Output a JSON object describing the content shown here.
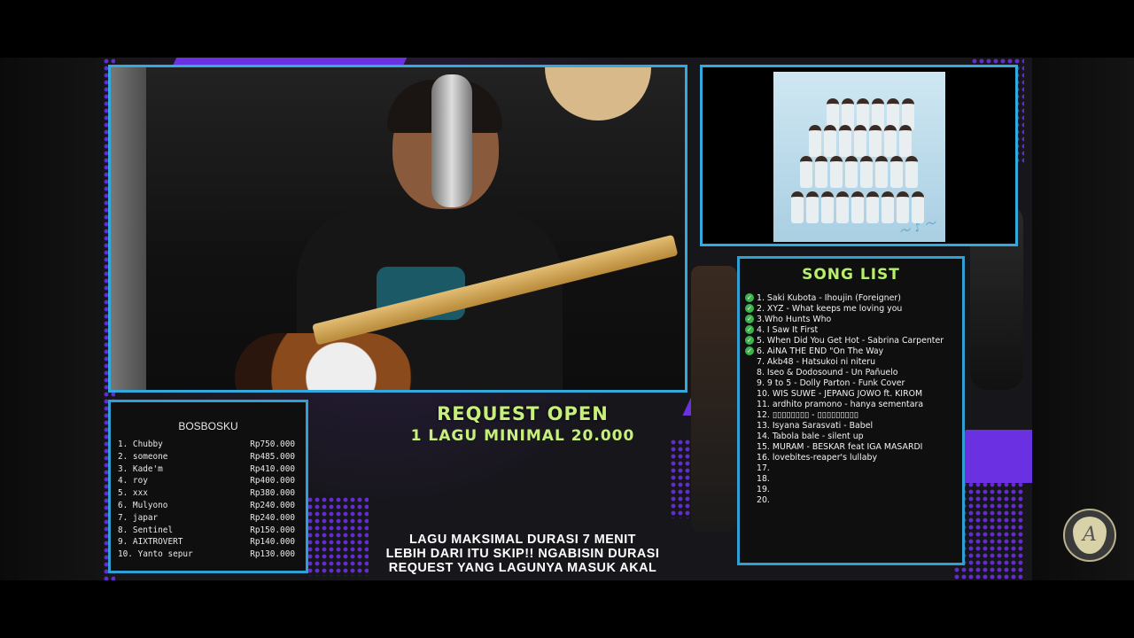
{
  "request": {
    "line1": "REQUEST OPEN",
    "line2": "1 LAGU MINIMAL 20.000"
  },
  "rules": [
    "LAGU MAKSIMAL DURASI 7 MENIT",
    "LEBIH DARI ITU SKIP!! NGABISIN DURASI",
    "REQUEST YANG LAGUNYA MASUK AKAL"
  ],
  "leaderboard": {
    "title": "BOSBOSKU",
    "entries": [
      {
        "name": "1. Chubby",
        "amount": "Rp750.000"
      },
      {
        "name": "2. someone",
        "amount": "Rp485.000"
      },
      {
        "name": "3. Kade'm",
        "amount": "Rp410.000"
      },
      {
        "name": "4. roy",
        "amount": "Rp400.000"
      },
      {
        "name": "5. xxx",
        "amount": "Rp380.000"
      },
      {
        "name": "6. Mulyono",
        "amount": "Rp240.000"
      },
      {
        "name": "7. japar",
        "amount": "Rp240.000"
      },
      {
        "name": "8. Sentinel",
        "amount": "Rp150.000"
      },
      {
        "name": "9. AIXTROVERT",
        "amount": "Rp140.000"
      },
      {
        "name": "10. Yanto sepur",
        "amount": "Rp130.000"
      }
    ]
  },
  "song_list": {
    "title": "SONG LIST",
    "items": [
      {
        "text": "1. Saki Kubota - Ihoujin (Foreigner)",
        "done": true
      },
      {
        "text": "2. XYZ - What keeps me loving you",
        "done": true
      },
      {
        "text": "3.Who Hunts Who",
        "done": true
      },
      {
        "text": "4. I Saw It First",
        "done": true
      },
      {
        "text": "5. When Did You Get Hot - Sabrina Carpenter",
        "done": true
      },
      {
        "text": "6. AiNA THE END \"On The Way",
        "done": true
      },
      {
        "text": "7. Akb48 - Hatsukoi ni niteru",
        "done": false
      },
      {
        "text": "8. Iseo & Dodosound - Un Pañuelo",
        "done": false
      },
      {
        "text": "9. 9 to 5 - Dolly Parton - Funk Cover",
        "done": false
      },
      {
        "text": "10. WIS SUWE - JEPANG JOWO ft. KIROM",
        "done": false
      },
      {
        "text": "11. ardhito pramono - hanya sementara",
        "done": false
      },
      {
        "text": "12. ▯▯▯▯▯▯▯▯ - ▯▯▯▯▯▯▯▯▯",
        "done": false
      },
      {
        "text": "13. Isyana Sarasvati - Babel",
        "done": false
      },
      {
        "text": "14. Tabola bale - silent up",
        "done": false
      },
      {
        "text": "15. MURAM - BESKAR feat IGA MASARDI",
        "done": false
      },
      {
        "text": "16. lovebites-reaper's lullaby",
        "done": false
      },
      {
        "text": "17.",
        "done": false
      },
      {
        "text": "18.",
        "done": false
      },
      {
        "text": "19.",
        "done": false
      },
      {
        "text": "20.",
        "done": false
      }
    ]
  },
  "icons": {
    "done_marker": "check-circle-icon",
    "channel_logo": "guitar-pick-logo-icon"
  },
  "colors": {
    "accent_green": "#c7f07a",
    "frame_blue": "#33a9de",
    "purple": "#6a31e0"
  }
}
